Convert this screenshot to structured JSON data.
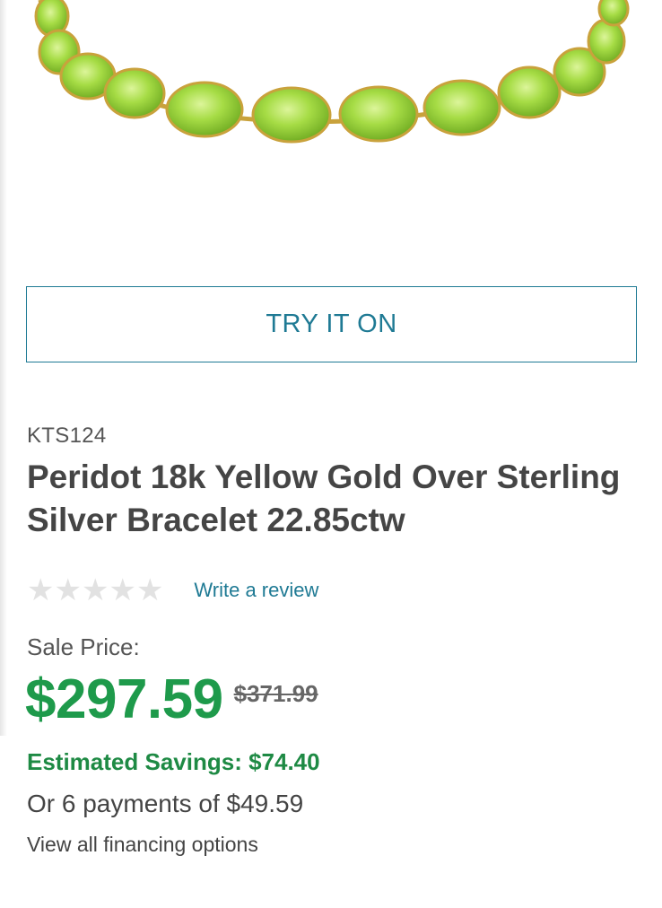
{
  "product": {
    "image_alt": "Peridot bracelet",
    "try_on_label": "TRY IT ON",
    "sku": "KTS124",
    "title": "Peridot 18k Yellow Gold Over Sterling Silver Bracelet 22.85ctw",
    "rating": 0,
    "rating_max": 5,
    "write_review_label": "Write a review"
  },
  "pricing": {
    "sale_label": "Sale Price:",
    "sale_price": "$297.59",
    "original_price": "$371.99",
    "savings": "Estimated Savings: $74.40",
    "payments": "Or 6 payments of $49.59",
    "financing_link": "View all financing options"
  },
  "colors": {
    "accent_teal": "#1f7a94",
    "price_green": "#1e9a4b",
    "star_empty": "#e2e2e2"
  }
}
